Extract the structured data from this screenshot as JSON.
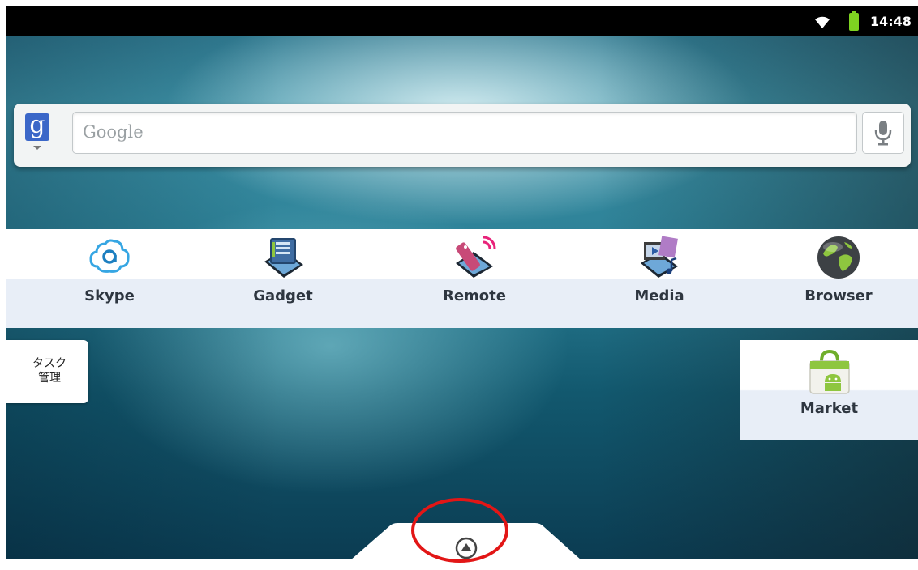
{
  "status_bar": {
    "time": "14:48",
    "wifi_icon": "wifi-icon",
    "battery_icon": "battery-icon"
  },
  "search": {
    "logo_letter": "g",
    "placeholder": "Google",
    "voice_icon": "mic-icon"
  },
  "apps": [
    {
      "label": "Skype",
      "icon": "skype-icon"
    },
    {
      "label": "Gadget",
      "icon": "gadget-icon"
    },
    {
      "label": "Remote",
      "icon": "remote-icon"
    },
    {
      "label": "Media",
      "icon": "media-icon"
    },
    {
      "label": "Browser",
      "icon": "browser-icon"
    }
  ],
  "task_manager": {
    "label": "タスク\n管理"
  },
  "market": {
    "label": "Market",
    "icon": "market-icon"
  },
  "dock": {
    "all_apps_icon": "up-arrow-icon"
  },
  "colors": {
    "highlight": "#e21616",
    "battery": "#7ed321",
    "google_blue": "#3b67c8"
  }
}
